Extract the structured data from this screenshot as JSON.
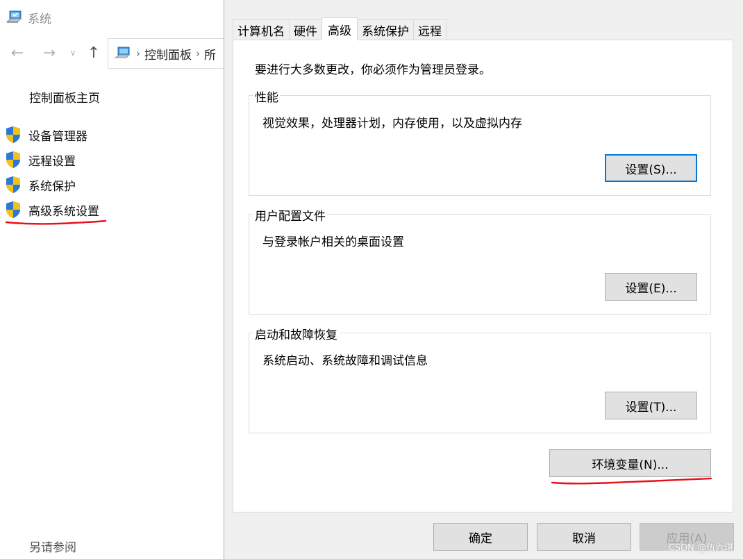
{
  "system_window": {
    "title": "系统",
    "address": {
      "crumb_1": "控制面板",
      "crumb_2": "所"
    },
    "control_panel_home": "控制面板主页",
    "links": [
      {
        "label": "设备管理器",
        "icon": "uac-shield-icon"
      },
      {
        "label": "远程设置",
        "icon": "uac-shield-icon"
      },
      {
        "label": "系统保护",
        "icon": "uac-shield-icon"
      },
      {
        "label": "高级系统设置",
        "icon": "uac-shield-icon"
      }
    ],
    "see_also": "另请参阅"
  },
  "dialog": {
    "tabs": [
      {
        "label": "计算机名",
        "active": false
      },
      {
        "label": "硬件",
        "active": false
      },
      {
        "label": "高级",
        "active": true
      },
      {
        "label": "系统保护",
        "active": false
      },
      {
        "label": "远程",
        "active": false
      }
    ],
    "admin_note": "要进行大多数更改，你必须作为管理员登录。",
    "groups": [
      {
        "title": "性能",
        "description": "视觉效果，处理器计划，内存使用，以及虚拟内存",
        "button": "设置(S)..."
      },
      {
        "title": "用户配置文件",
        "description": "与登录帐户相关的桌面设置",
        "button": "设置(E)..."
      },
      {
        "title": "启动和故障恢复",
        "description": "系统启动、系统故障和调试信息",
        "button": "设置(T)..."
      }
    ],
    "env_button": "环境变量(N)...",
    "ok_button": "确定",
    "cancel_button": "取消",
    "apply_button": "应用(A)"
  },
  "colors": {
    "accent": "#0078d7",
    "annotation_red": "#e8101a",
    "dialog_bg": "#f0f0f0"
  },
  "watermark": "CSDN @伍六琪"
}
